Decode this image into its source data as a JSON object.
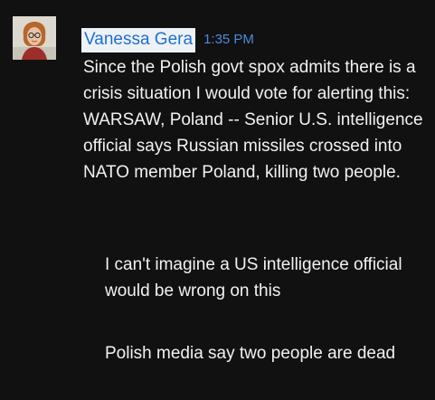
{
  "post": {
    "author": "Vanessa Gera",
    "time": "1:35 PM",
    "avatar_icon": "user-photo-icon",
    "message": "Since the Polish govt spox admits there is a crisis situation I would vote for alerting this: WARSAW, Poland -- Senior U.S. intelligence official says Russian missiles crossed into NATO member Poland, killing two people."
  },
  "followups": [
    "I can't imagine a US intelligence official would be wrong on this",
    "Polish media say two people are dead"
  ],
  "colors": {
    "background": "#111111",
    "text": "#f2f2f2",
    "author_name": "#1f6ed1",
    "author_highlight": "#eef2f6",
    "timestamp": "#4a8bdb"
  }
}
